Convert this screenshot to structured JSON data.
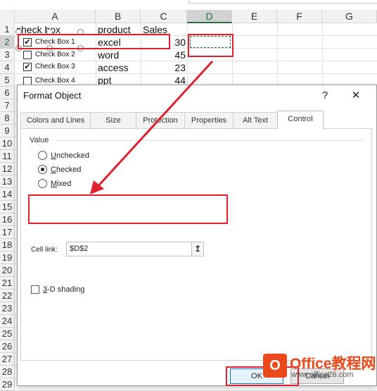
{
  "sheet": {
    "columns": [
      "A",
      "B",
      "C",
      "D",
      "E",
      "F",
      "G"
    ],
    "selected_column": "D",
    "rows": [
      "1",
      "2",
      "3",
      "4",
      "5",
      "6",
      "7",
      "8",
      "9",
      "10",
      "11",
      "12",
      "13",
      "14",
      "15",
      "16",
      "17",
      "18",
      "19",
      "20",
      "21",
      "22",
      "23",
      "24",
      "25",
      "26",
      "27",
      "28",
      "29"
    ],
    "selected_row": "2",
    "header_row": {
      "a": "check box",
      "b": "product",
      "c": "Sales"
    },
    "data_rows": [
      {
        "checkbox_label": "Check Box 1",
        "checked": true,
        "product": "excel",
        "sales": "30"
      },
      {
        "checkbox_label": "Check Box 2",
        "checked": false,
        "product": "word",
        "sales": "45"
      },
      {
        "checkbox_label": "Check Box 3",
        "checked": true,
        "product": "access",
        "sales": "23"
      },
      {
        "checkbox_label": "Check Box 4",
        "checked": false,
        "product": "ppt",
        "sales": "44"
      }
    ]
  },
  "dialog": {
    "title": "Format Object",
    "help": "?",
    "close": "✕",
    "tabs": [
      "Colors and Lines",
      "Size",
      "Protection",
      "Properties",
      "Alt Text",
      "Control"
    ],
    "active_tab": "Control",
    "value_group": "Value",
    "radios": [
      {
        "label_first": "U",
        "label_rest": "nchecked",
        "selected": false
      },
      {
        "label_first": "C",
        "label_rest": "hecked",
        "selected": true
      },
      {
        "label_first": "M",
        "label_rest": "ixed",
        "selected": false
      }
    ],
    "cell_link_label": "Cell link:",
    "cell_link_value": "$D$2",
    "collapse_icon": "↥",
    "shading_first": "3",
    "shading_rest": "-D shading",
    "ok_label": "OK",
    "cancel_label": "Cancel"
  },
  "watermark": {
    "name": "Office教程网",
    "url": "www.office26.com"
  },
  "colors": {
    "accent_red": "#e0202f",
    "excel_green": "#217346",
    "watermark_orange": "#ea4a1b"
  }
}
